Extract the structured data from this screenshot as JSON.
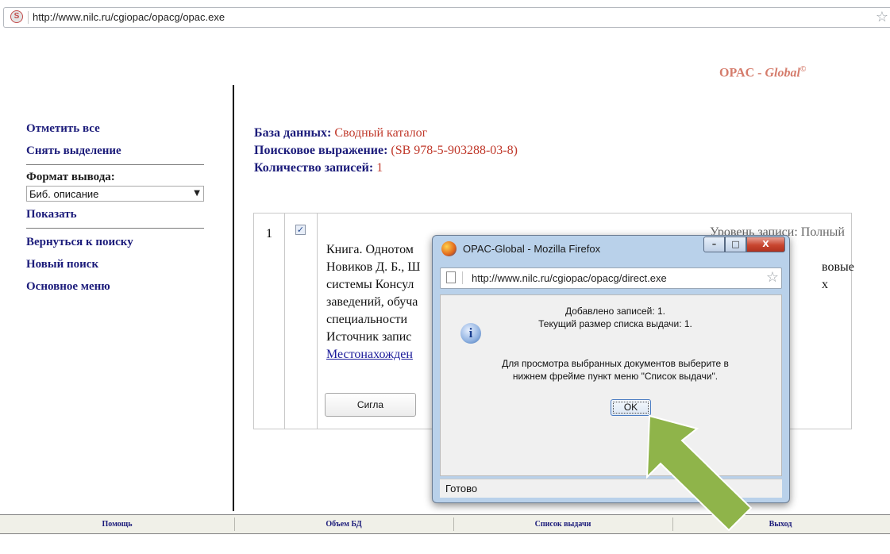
{
  "browser": {
    "site_icon_glyph": "S",
    "url": "http://www.nilc.ru/cgiopac/opacg/opac.exe"
  },
  "logo": {
    "prefix": "OPAC - ",
    "italic": "Global",
    "mark": "©"
  },
  "nav": {
    "select_all": "Отметить все",
    "deselect": "Снять выделение",
    "format_label": "Формат вывода:",
    "format_value": "Биб. описание",
    "show": "Показать",
    "back_to_search": "Вернуться к поиску",
    "new_search": "Новый поиск",
    "main_menu": "Основное меню"
  },
  "info": {
    "db_label": "База данных:",
    "db_value": " Сводный каталог",
    "query_label": "Поисковое выражение:",
    "query_value": " (SB 978-5-903288-03-8)",
    "count_label": "Количество записей:",
    "count_value": " 1"
  },
  "record": {
    "number": "1",
    "checked": true,
    "level": "Уровень записи: Полный",
    "lines": [
      "Книга. Однотом",
      "Новиков Д. Б., Ш",
      "системы Консул",
      "заведений, обуча",
      "специальности",
      "Источник запис"
    ],
    "link": "Местонахожден",
    "tail_1": "вовые",
    "tail_2": "х",
    "sigla_button": "Сигла"
  },
  "bottom_menu": {
    "help": "Помощь",
    "db_volume": "Объем БД",
    "issue_list": "Список выдачи",
    "exit": "Выход"
  },
  "dialog": {
    "title": "OPAC-Global - Mozilla Firefox",
    "url": "http://www.nilc.ru/cgiopac/opacg/direct.exe",
    "msg_line1": "Добавлено записей: 1.",
    "msg_line2": "Текущий размер списка выдачи: 1.",
    "msg_line3": "Для просмотра выбранных документов выберите в",
    "msg_line4": "нижнем фрейме пункт меню \"Список выдачи\".",
    "ok_button": "OK",
    "status": "Готово",
    "minimize_glyph": "–",
    "maximize_glyph": "□",
    "close_glyph": "X"
  },
  "colors": {
    "nav_link": "#1b1b7a",
    "value_red": "#c0392b",
    "logo": "#d57c6c",
    "arrow_green": "#8fb44a"
  }
}
